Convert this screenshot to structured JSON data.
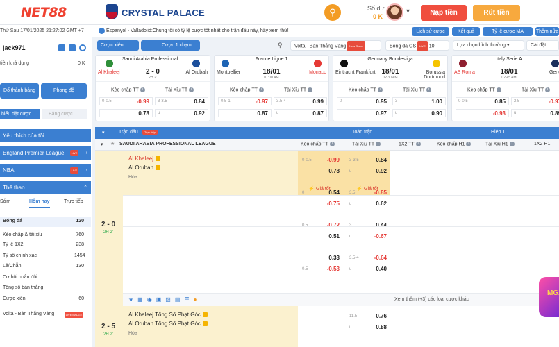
{
  "header": {
    "logo": "NET88",
    "club": "CRYSTAL PALACE",
    "balance_label": "Số dư",
    "balance_value": "0 K",
    "deposit_btn": "Nạp tiền",
    "withdraw_btn": "Rút tiền"
  },
  "subbar": {
    "datetime": "Thứ Sáu 17/01/2025 21:27:02 GMT +7",
    "ticker": "Espanyol - Valladolid:Chúng tôi có tỷ lệ cược tốt nhất cho trận đấu này, hãy xem thử!",
    "buttons": [
      "Lịch sử cược",
      "Kết quả",
      "Tỷ lệ cược MA",
      "Thêm nữa"
    ]
  },
  "sidebar": {
    "username": "jack971",
    "wallet_label": "tiền khả dụng",
    "wallet_value": "0 K",
    "btn_left": "Đổ thành bảng",
    "btn_right": "Phong độ",
    "tab_active": "hiểu đặt cược",
    "tab_inactive": "Bảng cược",
    "sections": [
      "Yêu thích của tôi",
      "England Premier League",
      "NBA",
      "Thể thao"
    ],
    "subtabs": [
      "Sớm",
      "Hôm nay",
      "Trực tiếp"
    ],
    "rows": [
      {
        "label": "Bóng đá",
        "value": "120"
      },
      {
        "label": "Kèo chấp & tài xỉu",
        "value": "760"
      },
      {
        "label": "Tỷ lệ 1X2",
        "value": "238"
      },
      {
        "label": "Tỷ số chính xác",
        "value": "1454"
      },
      {
        "label": "Lẻ/Chẵn",
        "value": "130"
      },
      {
        "label": "Cơ hội nhân đôi",
        "value": ""
      },
      {
        "label": "Tổng số bàn thắng",
        "value": ""
      },
      {
        "label": "Cược xiên",
        "value": "60"
      }
    ],
    "live_badge": "LIVE",
    "volta": "Volta - Bàn Thắng Vàng",
    "volta_badge": "LIVE BADGE"
  },
  "filter": {
    "parlay": "Cược xiên",
    "single": "Cược 1 chạm",
    "volta": "Volta - Bàn Thắng Vàng",
    "volta_badge": "New Game",
    "bdgs": "Bóng đá GS",
    "live": "LIVE",
    "count": "10",
    "sort": "Lựa chọn bình thường",
    "settings": "Cài đặt"
  },
  "cards": [
    {
      "league": "Saudi Arabia Professional ...",
      "score": "2 - 0",
      "sub": "2H 2'",
      "home": "Al Khaleej",
      "away": "Al Orubah",
      "hlabel": "Kèo chấp TT",
      "olabel": "Tài Xỉu TT",
      "rows": [
        [
          "0-0.5",
          "-0.99",
          "3-3.5",
          "0.84"
        ],
        [
          "",
          "0.78",
          "u",
          "0.92"
        ]
      ]
    },
    {
      "league": "France Ligue 1",
      "score": "18/01",
      "sub": "01:00 AM",
      "home": "Montpellier",
      "away": "Monaco",
      "hlabel": "Kèo chấp TT",
      "olabel": "Tài Xỉu TT",
      "rows": [
        [
          "0.5-1",
          "-0.97",
          "3.5-4",
          "0.99"
        ],
        [
          "",
          "0.87",
          "u",
          "0.87"
        ]
      ]
    },
    {
      "league": "Germany Bundesliga",
      "score": "18/01",
      "sub": "02:30 AM",
      "home": "Eintracht Frankfurt",
      "away": "Borussia Dortmund",
      "hlabel": "Kèo chấp TT",
      "olabel": "Tài Xỉu TT",
      "rows": [
        [
          "0",
          "0.95",
          "3",
          "1.00"
        ],
        [
          "",
          "0.97",
          "u",
          "0.90"
        ]
      ]
    },
    {
      "league": "Italy Serie A",
      "score": "18/01",
      "sub": "02:45 AM",
      "home": "AS Roma",
      "away": "Genoa",
      "hlabel": "Kèo chấp TT",
      "olabel": "Tài Xỉu TT",
      "rows": [
        [
          "0-0.5",
          "0.85",
          "2.5",
          "-0.97"
        ],
        [
          "",
          "-0.93",
          "u",
          "0.89"
        ]
      ]
    }
  ],
  "table": {
    "head_match": "Trận đấu",
    "head_live": "Trực tiếp",
    "head_full": "Toàn trận",
    "head_h1": "Hiệp 1",
    "cols": [
      "Kèo chấp TT",
      "Tài Xỉu TT",
      "1X2 TT",
      "Kèo chấp H1",
      "Tài Xỉu H1",
      "1X2 H1"
    ],
    "league": "SAUDI ARABIA PROFESSIONAL LEAGUE",
    "m1": {
      "home": "Al Khaleej",
      "away": "Al Orubah",
      "draw": "Hòa",
      "score": "2 - 0",
      "time": "2H 2'",
      "good": "Giá tốt",
      "lines": [
        [
          [
            "0-0.5",
            "-0.99"
          ],
          [
            "",
            "0.78"
          ],
          [
            "3-3.5",
            "0.84"
          ],
          [
            "u",
            "0.92"
          ]
        ],
        [
          [
            "0",
            "0.54"
          ],
          [
            "",
            "-0.75"
          ],
          [
            "3.5",
            "-0.85"
          ],
          [
            "u",
            "0.62"
          ]
        ],
        [
          [
            "0.5",
            "-0.72"
          ],
          [
            "",
            "0.51"
          ],
          [
            "3",
            "0.44"
          ],
          [
            "u",
            "-0.67"
          ]
        ],
        [
          [
            "",
            "0.33"
          ],
          [
            "0.5",
            "-0.53"
          ],
          [
            "3.5-4",
            "-0.64"
          ],
          [
            "u",
            "0.40"
          ]
        ]
      ],
      "more": "Xem thêm (+3) các loại cược khác"
    },
    "m2": {
      "home": "Al Khaleej Tổng Số Phạt Góc",
      "away": "Al Orubah Tổng Số Phạt Góc",
      "draw": "Hòa",
      "score": "2 - 5",
      "time": "2H 2'",
      "lines": [
        [
          [
            "11.5",
            "0.76"
          ],
          [
            "u",
            "0.88"
          ]
        ]
      ]
    }
  },
  "promo": "MGA"
}
